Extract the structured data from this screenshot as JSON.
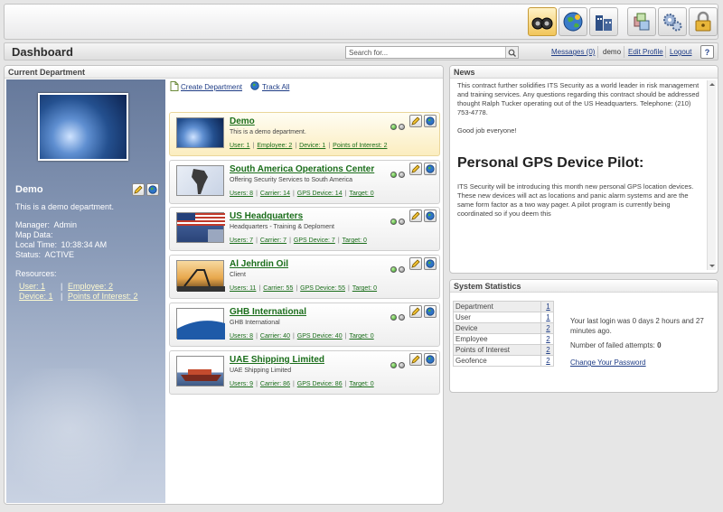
{
  "toolbar": {
    "buttons": [
      {
        "icon": "tracking-icon",
        "active": true
      },
      {
        "icon": "globe-icon",
        "active": false
      },
      {
        "icon": "buildings-icon",
        "active": false
      },
      {
        "icon": "boxes-icon",
        "active": false
      },
      {
        "icon": "gears-icon",
        "active": false
      },
      {
        "icon": "padlock-icon",
        "active": false
      }
    ]
  },
  "header": {
    "title": "Dashboard",
    "search_placeholder": "Search for...",
    "messages": "Messages (0)",
    "user": "demo",
    "edit_profile": "Edit Profile",
    "logout": "Logout",
    "help": "?"
  },
  "current_department": {
    "panel_title": "Current Department",
    "name": "Demo",
    "description": "This is a demo department.",
    "details": [
      {
        "label": "Manager:",
        "value": "Admin"
      },
      {
        "label": "Map Data:",
        "value": ""
      },
      {
        "label": "Local Time:",
        "value": "10:38:34 AM"
      },
      {
        "label": "Status:",
        "value": "ACTIVE"
      }
    ],
    "resources_label": "Resources:",
    "resources": {
      "user": "User: 1",
      "employee": "Employee: 2",
      "device": "Device: 1",
      "poi": "Points of Interest: 2"
    },
    "actions": {
      "create": "Create Department",
      "track": "Track All"
    },
    "departments": [
      {
        "name": "Demo",
        "sub": "This is a demo department.",
        "stats": [
          "User: 1",
          "Employee: 2",
          "Device: 1",
          "Points of Interest: 2"
        ],
        "active": true
      },
      {
        "name": "South America Operations Center",
        "sub": "Offering Security Services to South America",
        "stats": [
          "Users: 8",
          "Carrier: 14",
          "GPS Device: 14",
          "Target: 0"
        ],
        "active": false
      },
      {
        "name": "US Headquarters",
        "sub": "Headquarters - Training & Deploment",
        "stats": [
          "Users: 7",
          "Carrier: 7",
          "GPS Device: 7",
          "Target: 0"
        ],
        "active": false
      },
      {
        "name": "Al Jehrdin Oil",
        "sub": "Client",
        "stats": [
          "Users: 11",
          "Carrier: 55",
          "GPS Device: 55",
          "Target: 0"
        ],
        "active": false
      },
      {
        "name": "GHB International",
        "sub": "GHB International",
        "stats": [
          "Users: 8",
          "Carrier: 40",
          "GPS Device: 40",
          "Target: 0"
        ],
        "active": false
      },
      {
        "name": "UAE Shipping Limited",
        "sub": "UAE Shipping Limited",
        "stats": [
          "Users: 9",
          "Carrier: 86",
          "GPS Device: 86",
          "Target: 0"
        ],
        "active": false
      }
    ]
  },
  "news": {
    "panel_title": "News",
    "p1": "This contract further solidifies ITS Security as a world leader in risk management and training services.  Any questions regarding this contract should be addressed thought Ralph Tucker operating out of the US Headquarters. Telephone: (210) 753-4778.",
    "p2": "Good job everyone!",
    "headline": "Personal GPS Device Pilot:",
    "p3": "ITS Security will be introducing this month new personal GPS location devices.  These new devices will act as locations and panic alarm systems and are the same form factor as a two way pager.  A pilot program is currently being coordinated so if you deem this"
  },
  "stats": {
    "panel_title": "System Statistics",
    "rows": [
      {
        "label": "Department",
        "value": "1"
      },
      {
        "label": "User",
        "value": "1"
      },
      {
        "label": "Device",
        "value": "2"
      },
      {
        "label": "Employee",
        "value": "2"
      },
      {
        "label": "Points of Interest",
        "value": "2"
      },
      {
        "label": "Geofence",
        "value": "2"
      }
    ],
    "last_login": "Your last login was 0 days 2 hours and 27 minutes ago.",
    "failed_label": "Number of failed attempts:",
    "failed_value": "0",
    "change_password": "Change Your Password"
  },
  "colors": {
    "accent_link": "#1f3d86",
    "dept_link": "#1b6e1b",
    "sidebar": "#66799b",
    "active_card": "#fbedbf"
  }
}
